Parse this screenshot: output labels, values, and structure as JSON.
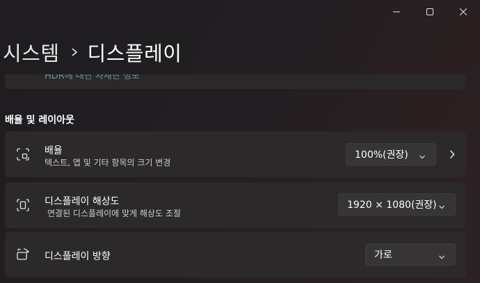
{
  "window": {
    "minimize_icon": "minimize-icon",
    "maximize_icon": "maximize-icon",
    "close_icon": "close-icon"
  },
  "breadcrumb": {
    "parent": "시스템",
    "separator_icon": "chevron-right-icon",
    "current": "디스플레이"
  },
  "scrolled_card": {
    "link": "HDR에 대한 자세한 정보"
  },
  "section": {
    "title": "배율 및 레이아웃"
  },
  "scale": {
    "icon": "scale-icon",
    "title": "배율",
    "subtitle": "텍스트, 앱 및 기타 항목의 크기 변경",
    "value": "100%(권장)",
    "dropdown_icon": "chevron-down-icon",
    "nav_icon": "chevron-right-icon"
  },
  "resolution": {
    "icon": "resolution-icon",
    "title": "디스플레이 해상도",
    "subtitle": "연결된 디스플레이에 맞게 해상도 조절",
    "value": "1920 × 1080(권장)",
    "dropdown_icon": "chevron-down-icon"
  },
  "orientation": {
    "icon": "orientation-icon",
    "title": "디스플레이 방향",
    "value": "가로",
    "dropdown_icon": "chevron-down-icon"
  },
  "colors": {
    "accent_link": "#99ebff",
    "card_background": "#2c292a",
    "dropdown_background": "#373435"
  }
}
